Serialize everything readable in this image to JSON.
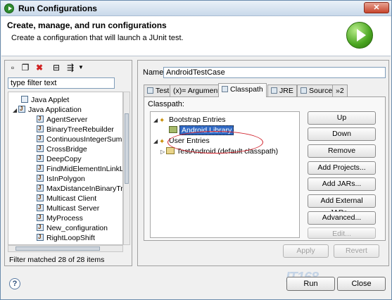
{
  "window": {
    "title": "Run Configurations",
    "close_label": "✕"
  },
  "header": {
    "title": "Create, manage, and run configurations",
    "subtitle": "Create a configuration that will launch a JUnit test."
  },
  "left": {
    "filter_placeholder": "type filter text",
    "tree": [
      {
        "label": "Java Applet",
        "icon": "java-applet-icon"
      },
      {
        "label": "Java Application",
        "icon": "java-app-icon",
        "expanded": true
      },
      {
        "label": "AgentServer"
      },
      {
        "label": "BinaryTreeRebuilder"
      },
      {
        "label": "ContinuousIntegerSum"
      },
      {
        "label": "CrossBridge"
      },
      {
        "label": "DeepCopy"
      },
      {
        "label": "FindMidElementInLinkList"
      },
      {
        "label": "IsInPolygon"
      },
      {
        "label": "MaxDistanceInBinaryTree"
      },
      {
        "label": "Multicast Client"
      },
      {
        "label": "Multicast Server"
      },
      {
        "label": "MyProcess"
      },
      {
        "label": "New_configuration"
      },
      {
        "label": "RightLoopShift"
      }
    ],
    "status": "Filter matched 28 of 28 items"
  },
  "right": {
    "name_label": "Name:",
    "name_value": "AndroidTestCase",
    "tabs": [
      "Test",
      "(x)= Arguments",
      "Classpath",
      "JRE",
      "Source",
      "»2"
    ],
    "active_tab": "Classpath",
    "classpath_label": "Classpath:",
    "classpath_tree": {
      "bootstrap": "Bootstrap Entries",
      "android_lib": "Android Library",
      "user": "User Entries",
      "test_project": "TestAndroid (default classpath)"
    },
    "buttons": [
      "Up",
      "Down",
      "Remove",
      "Add Projects...",
      "Add JARs...",
      "Add External JARs...",
      "Advanced...",
      "Edit..."
    ],
    "apply": "Apply",
    "revert": "Revert"
  },
  "footer": {
    "help": "?",
    "run": "Run",
    "close": "Close"
  },
  "watermark": "IT168"
}
